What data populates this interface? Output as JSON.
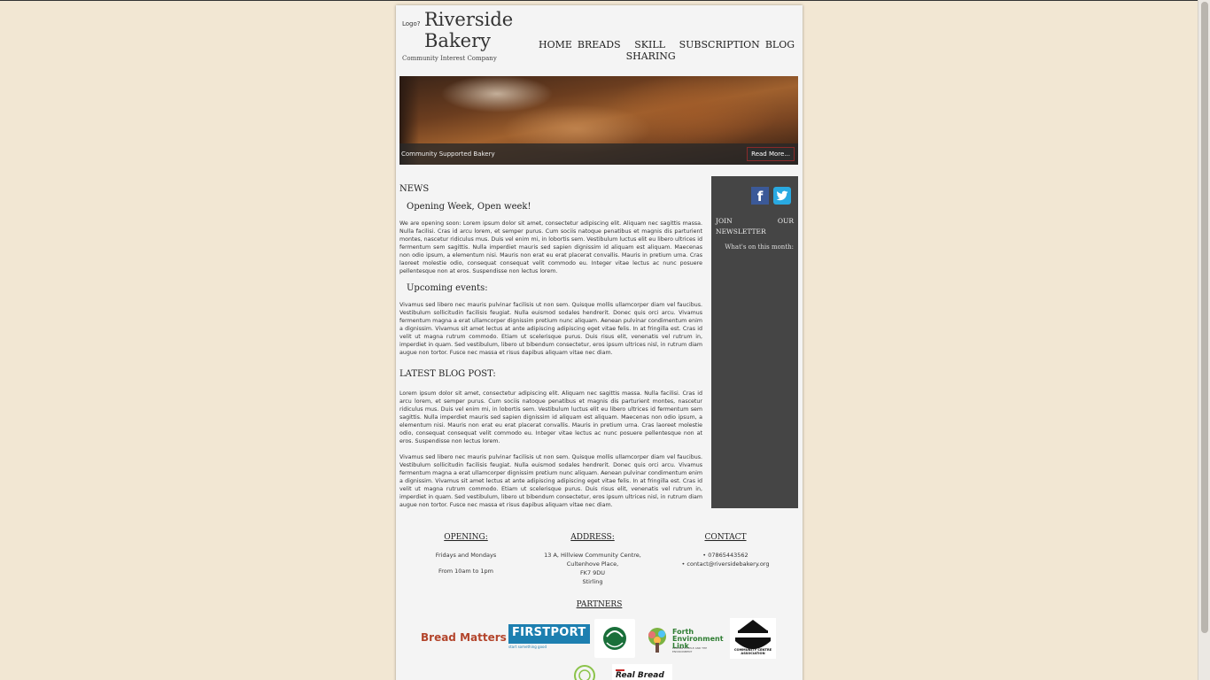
{
  "header": {
    "logo_placeholder": "Logo?",
    "brand_line1": "Riverside",
    "brand_line2": "Bakery",
    "tagline": "Community Interest Company"
  },
  "nav": {
    "items": [
      {
        "label": "HOME"
      },
      {
        "label": "BREADS"
      },
      {
        "label": "SKILL SHARING"
      },
      {
        "label": "SUBSCRIPTION"
      },
      {
        "label": "BLOG"
      }
    ]
  },
  "hero": {
    "caption": "Community Supported Bakery",
    "button": "Read More..."
  },
  "news": {
    "heading": "NEWS",
    "item1_title": "Opening Week, Open week!",
    "item1_text": "We are opening soon: Lorem ipsum dolor sit amet, consectetur adipiscing elit. Aliquam nec sagittis massa. Nulla facilisi. Cras id arcu lorem, et semper purus. Cum sociis natoque penatibus et magnis dis parturient montes, nascetur ridiculus mus. Duis vel enim mi, in lobortis sem. Vestibulum luctus elit eu libero ultrices id fermentum sem sagittis. Nulla imperdiet mauris sed sapien dignissim id aliquam est aliquam. Maecenas non odio ipsum, a elementum nisi. Mauris non erat eu erat placerat convallis. Mauris in pretium urna. Cras laoreet molestie odio, consequat consequat velit commodo eu. Integer vitae lectus ac nunc posuere pellentesque non at eros. Suspendisse non lectus lorem.",
    "item2_title": "Upcoming events:",
    "item2_text": "Vivamus sed libero nec mauris pulvinar facilisis ut non sem. Quisque mollis ullamcorper diam vel faucibus. Vestibulum sollicitudin facilisis feugiat. Nulla euismod sodales hendrerit. Donec quis orci arcu. Vivamus fermentum magna a erat ullamcorper dignissim pretium nunc aliquam. Aenean pulvinar condimentum enim a dignissim. Vivamus sit amet lectus at ante adipiscing adipiscing eget vitae felis. In at fringilla est. Cras id velit ut magna rutrum commodo. Etiam ut scelerisque purus. Duis risus elit, venenatis vel rutrum in, imperdiet in quam. Sed vestibulum, libero ut bibendum consectetur, eros ipsum ultrices nisl, in rutrum diam augue non tortor. Fusce nec massa et risus dapibus aliquam vitae nec diam."
  },
  "blog": {
    "heading": "LATEST BLOG POST:",
    "para1": "Lorem ipsum dolor sit amet, consectetur adipiscing elit. Aliquam nec sagittis massa. Nulla facilisi. Cras id arcu lorem, et semper purus. Cum sociis natoque penatibus et magnis dis parturient montes, nascetur ridiculus mus. Duis vel enim mi, in lobortis sem. Vestibulum luctus elit eu libero ultrices id fermentum sem sagittis. Nulla imperdiet mauris sed sapien dignissim id aliquam est aliquam. Maecenas non odio ipsum, a elementum nisi. Mauris non erat eu erat placerat convallis. Mauris in pretium urna. Cras laoreet molestie odio, consequat consequat velit commodo eu. Integer vitae lectus ac nunc posuere pellentesque non at eros. Suspendisse non lectus lorem.",
    "para2": "Vivamus sed libero nec mauris pulvinar facilisis ut non sem. Quisque mollis ullamcorper diam vel faucibus. Vestibulum sollicitudin facilisis feugiat. Nulla euismod sodales hendrerit. Donec quis orci arcu. Vivamus fermentum magna a erat ullamcorper dignissim pretium nunc aliquam. Aenean pulvinar condimentum enim a dignissim. Vivamus sit amet lectus at ante adipiscing adipiscing eget vitae felis. In at fringilla est. Cras id velit ut magna rutrum commodo. Etiam ut scelerisque purus. Duis risus elit, venenatis vel rutrum in, imperdiet in quam. Sed vestibulum, libero ut bibendum consectetur, eros ipsum ultrices nisl, in rutrum diam augue non tortor. Fusce nec massa et risus dapibus aliquam vitae nec diam."
  },
  "sidebar": {
    "facebook_icon": "facebook-icon",
    "twitter_icon": "twitter-icon",
    "join_line1_a": "JOIN",
    "join_line1_b": "OUR",
    "join_line2": "NEWSLETTER",
    "whats_on": "What's on this month:"
  },
  "footer": {
    "opening": {
      "heading": "OPENING:",
      "days": "Fridays and Mondays",
      "hours": "From 10am to 1pm"
    },
    "address": {
      "heading": "ADDRESS:",
      "lines": [
        "13 A, Hillview Community Centre,",
        "Cultenhove Place,",
        "FK7 9DU",
        "Stirling"
      ]
    },
    "contact": {
      "heading": "CONTACT",
      "phone": "07865443562",
      "email": "contact@riversidebakery.org"
    },
    "partners_heading": "PARTNERS",
    "partners": {
      "bread_matters": "Bread Matters",
      "firstport": "FIRSTPORT",
      "firstport_sub": "start something good",
      "stirling": "Stirling Council",
      "forth": "Forth Environment Link",
      "forth_sub": "LINKING PEOPLE AND THE ENVIRONMENT",
      "cca": "COMMUNITY CENTRE ASSOCIATION",
      "realbread": "Real Bread"
    }
  },
  "colors": {
    "background": "#f2e7d3",
    "page": "#f4f4f4",
    "sidebar": "#454545",
    "facebook": "#3b5998",
    "twitter": "#29a9e1"
  }
}
